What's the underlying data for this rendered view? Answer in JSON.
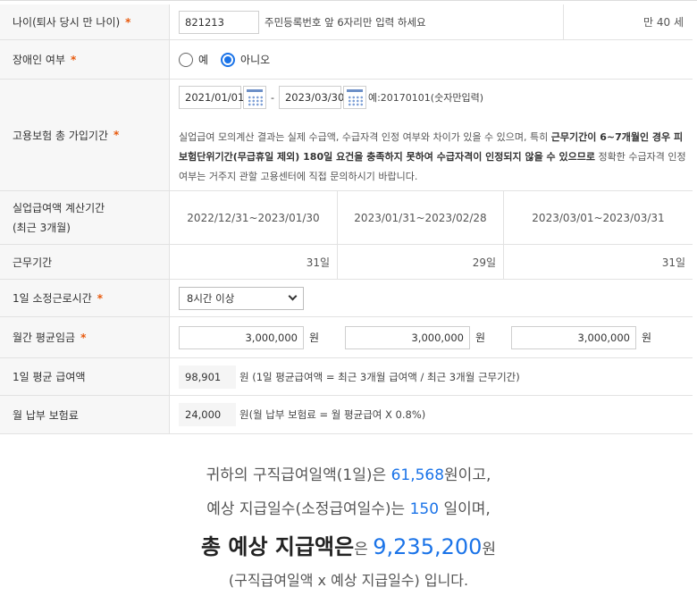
{
  "age": {
    "label": "나이(퇴사 당시 만 나이)",
    "value": "821213",
    "hint": "주민등록번호 앞 6자리만 입력 하세요",
    "result": "만 40 세"
  },
  "disability": {
    "label": "장애인 여부",
    "options": [
      "예",
      "아니오"
    ],
    "selected": "아니오"
  },
  "insurance": {
    "label": "고용보험 총 가입기간",
    "start": "2021/01/01",
    "end": "2023/03/30",
    "example": "예:20170101(숫자만입력)",
    "notice_1": "실업급여 모의계산 결과는 실제 수급액, 수급자격 인정 여부와 차이가 있을 수 있으며, 특히 ",
    "notice_bold_1": "근무기간이 6~7개월인 경우 피보험단위기간(무급휴일 제외) 180일 요건을 충족하지 못하여 수급자격이 인정되지 않을 수 있으므로",
    "notice_2": " 정확한 수급자격 인정 여부는 거주지 관할 고용센터에 직접 문의하시기 바랍니다."
  },
  "calc_period": {
    "label_line1": "실업급여액 계산기간",
    "label_line2": "(최근 3개월)",
    "periods": [
      "2022/12/31~2023/01/30",
      "2023/01/31~2023/02/28",
      "2023/03/01~2023/03/31"
    ]
  },
  "work_days": {
    "label": "근무기간",
    "values": [
      "31일",
      "29일",
      "31일"
    ]
  },
  "daily_hours": {
    "label": "1일 소정근로시간",
    "selected": "8시간 이상"
  },
  "monthly_wage": {
    "label": "월간 평균임금",
    "values": [
      "3,000,000",
      "3,000,000",
      "3,000,000"
    ],
    "unit": "원"
  },
  "daily_benefit": {
    "label": "1일 평균 급여액",
    "value": "98,901",
    "desc": "원 (1일 평균급여액 = 최근 3개월 급여액 / 최근 3개월 근무기간)"
  },
  "premium": {
    "label": "월 납부 보험료",
    "value": "24,000",
    "desc": "원(월 납부 보험료 = 월 평균급여 X 0.8%)"
  },
  "result": {
    "line1_pre": "귀하의 구직급여일액(1일)은 ",
    "daily_amount": "61,568",
    "line1_post": "원이고,",
    "line2_pre": "예상 지급일수(소정급여일수)는 ",
    "days": "150",
    "line2_post": " 일이며,",
    "line3_pre": "총 예상 지급액은",
    "line3_small": "은 ",
    "total": "9,235,200",
    "line3_post": "원",
    "line4": "(구직급여일액 x 예상 지급일수) 입니다."
  },
  "star": "*",
  "colors": {
    "accent": "#1a73e8",
    "required": "#e8590c"
  }
}
